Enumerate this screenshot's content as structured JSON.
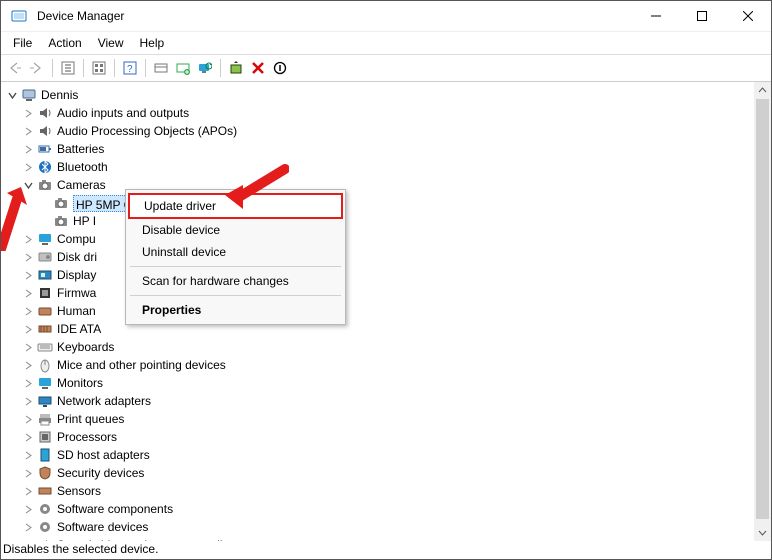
{
  "window": {
    "title": "Device Manager"
  },
  "menubar": {
    "file": "File",
    "action": "Action",
    "view": "View",
    "help": "Help"
  },
  "root": "Dennis",
  "cats": {
    "audio_io": "Audio inputs and outputs",
    "apo": "Audio Processing Objects (APOs)",
    "batt": "Batteries",
    "bt": "Bluetooth",
    "cam": "Cameras",
    "cam_hp5mp": "HP 5MP C",
    "cam_hpi": "HP I",
    "compu": "Compu",
    "diskdri": "Disk dri",
    "display": "Display",
    "firmwa": "Firmwa",
    "human": "Human",
    "ideata": "IDE ATA",
    "keyb": "Keyboards",
    "mice": "Mice and other pointing devices",
    "monitors": "Monitors",
    "netadapt": "Network adapters",
    "printq": "Print queues",
    "proc": "Processors",
    "sdhost": "SD host adapters",
    "secdev": "Security devices",
    "sensors": "Sensors",
    "swcomp": "Software components",
    "swdev": "Software devices",
    "svc_cut": "Sound  video and game controllers"
  },
  "ctx": {
    "update": "Update driver",
    "disable": "Disable device",
    "uninstall": "Uninstall device",
    "scan": "Scan for hardware changes",
    "properties": "Properties"
  },
  "status": "Disables the selected device."
}
